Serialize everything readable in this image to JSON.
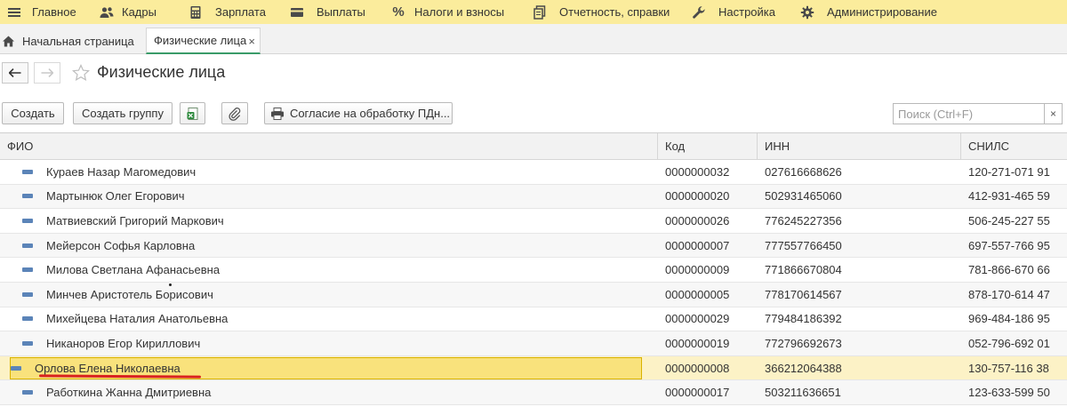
{
  "menu": [
    {
      "label": "Главное",
      "icon": "menu-lines-icon"
    },
    {
      "label": "Кадры",
      "icon": "people-icon"
    },
    {
      "label": "Зарплата",
      "icon": "calculator-icon"
    },
    {
      "label": "Выплаты",
      "icon": "wallet-icon"
    },
    {
      "label": "Налоги и взносы",
      "icon": "percent-icon"
    },
    {
      "label": "Отчетность, справки",
      "icon": "documents-icon"
    },
    {
      "label": "Настройка",
      "icon": "wrench-icon"
    },
    {
      "label": "Администрирование",
      "icon": "gear-icon"
    }
  ],
  "tabs": {
    "home": "Начальная страница",
    "active": "Физические лица",
    "close": "×"
  },
  "page": {
    "title": "Физические лица"
  },
  "toolbar": {
    "create": "Создать",
    "create_group": "Создать группу",
    "consent": "Согласие на обработку ПДн...",
    "search_placeholder": "Поиск (Ctrl+F)",
    "search_clear": "×"
  },
  "table": {
    "columns": [
      "ФИО",
      "Код",
      "ИНН",
      "СНИЛС"
    ],
    "selected_index": 8,
    "rows": [
      {
        "name": "Кураев Назар Магомедович",
        "code": "0000000032",
        "inn": "027616668626",
        "snils": "120-271-071 91"
      },
      {
        "name": "Мартынюк Олег Егорович",
        "code": "0000000020",
        "inn": "502931465060",
        "snils": "412-931-465 59"
      },
      {
        "name": "Матвиевский Григорий Маркович",
        "code": "0000000026",
        "inn": "776245227356",
        "snils": "506-245-227 55"
      },
      {
        "name": "Мейерсон Софья Карловна",
        "code": "0000000007",
        "inn": "777557766450",
        "snils": "697-557-766 95"
      },
      {
        "name": "Милова Светлана Афанасьевна",
        "code": "0000000009",
        "inn": "771866670804",
        "snils": "781-866-670 66"
      },
      {
        "name": "Минчев Аристотель Борисович",
        "code": "0000000005",
        "inn": "778170614567",
        "snils": "878-170-614 47"
      },
      {
        "name": "Михейцева Наталия Анатольевна",
        "code": "0000000029",
        "inn": "779484186392",
        "snils": "969-484-186 95"
      },
      {
        "name": "Никаноров Егор Кириллович",
        "code": "0000000019",
        "inn": "772796692673",
        "snils": "052-796-692 01"
      },
      {
        "name": "Орлова Елена Николаевна",
        "code": "0000000008",
        "inn": "366212064388",
        "snils": "130-757-116 38"
      },
      {
        "name": "Работкина Жанна Дмитриевна",
        "code": "0000000017",
        "inn": "503211636651",
        "snils": "123-633-599 50"
      }
    ]
  },
  "colors": {
    "menu_bg": "#fbec9c",
    "tab_accent": "#3a9b69",
    "selected_row": "#f9e27c",
    "annotation_underline": "#d9231f"
  }
}
